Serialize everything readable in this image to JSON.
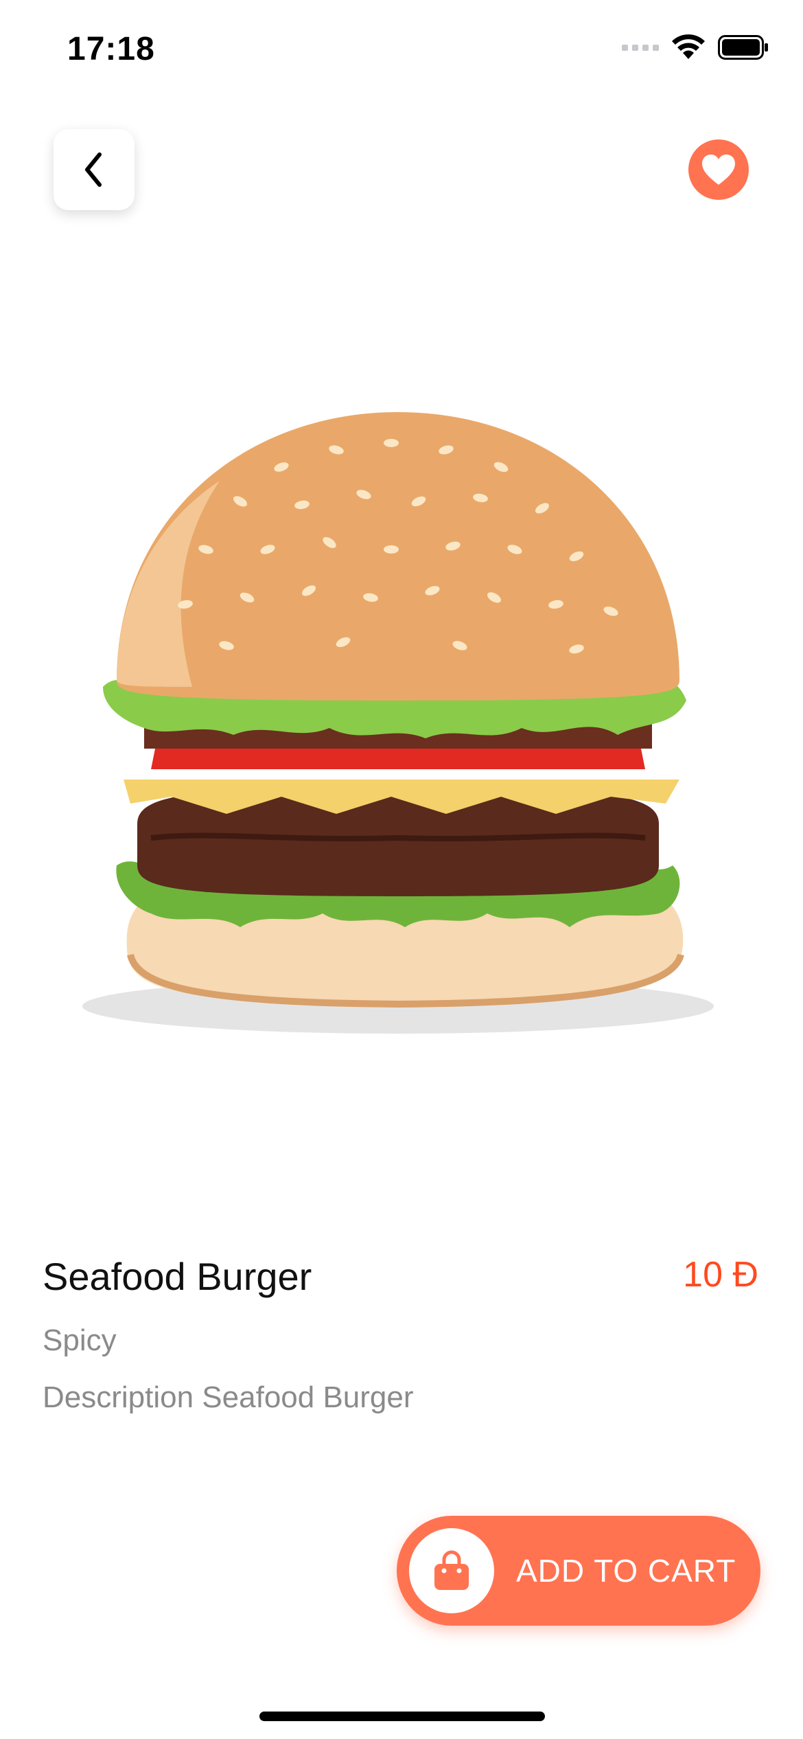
{
  "status_bar": {
    "time": "17:18"
  },
  "product": {
    "name": "Seafood Burger",
    "price": "10 Đ",
    "category": "Spicy",
    "description": "Description Seafood Burger"
  },
  "actions": {
    "add_to_cart_label": "ADD TO CART"
  },
  "colors": {
    "accent": "#FF7351",
    "price": "#FF4A1F",
    "muted_text": "#8A8A8A"
  },
  "icons": {
    "back": "chevron-left-icon",
    "favorite": "heart-icon",
    "cart": "shopping-bag-icon"
  }
}
